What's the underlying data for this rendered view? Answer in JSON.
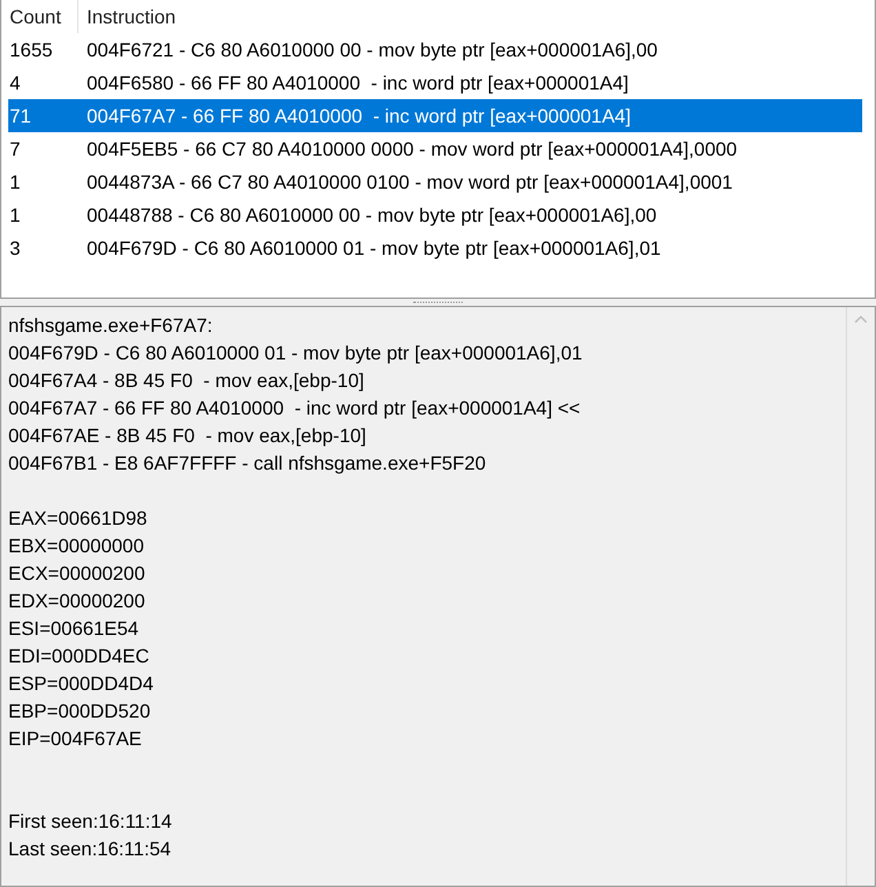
{
  "table": {
    "columns": [
      "Count",
      "Instruction"
    ],
    "rows": [
      {
        "count": "1655",
        "instruction": "004F6721 - C6 80 A6010000 00 - mov byte ptr [eax+000001A6],00",
        "selected": false
      },
      {
        "count": "4",
        "instruction": "004F6580 - 66 FF 80 A4010000  - inc word ptr [eax+000001A4]",
        "selected": false
      },
      {
        "count": "71",
        "instruction": "004F67A7 - 66 FF 80 A4010000  - inc word ptr [eax+000001A4]",
        "selected": true
      },
      {
        "count": "7",
        "instruction": "004F5EB5 - 66 C7 80 A4010000 0000 - mov word ptr [eax+000001A4],0000",
        "selected": false
      },
      {
        "count": "1",
        "instruction": "0044873A - 66 C7 80 A4010000 0100 - mov word ptr [eax+000001A4],0001",
        "selected": false
      },
      {
        "count": "1",
        "instruction": "00448788 - C6 80 A6010000 00 - mov byte ptr [eax+000001A6],00",
        "selected": false
      },
      {
        "count": "3",
        "instruction": "004F679D - C6 80 A6010000 01 - mov byte ptr [eax+000001A6],01",
        "selected": false
      }
    ]
  },
  "details": {
    "address": "nfshsgame.exe+F67A7:",
    "code_lines": [
      "004F679D - C6 80 A6010000 01 - mov byte ptr [eax+000001A6],01",
      "004F67A4 - 8B 45 F0  - mov eax,[ebp-10]",
      "004F67A7 - 66 FF 80 A4010000  - inc word ptr [eax+000001A4] <<",
      "004F67AE - 8B 45 F0  - mov eax,[ebp-10]",
      "004F67B1 - E8 6AF7FFFF - call nfshsgame.exe+F5F20"
    ],
    "registers": [
      "EAX=00661D98",
      "EBX=00000000",
      "ECX=00000200",
      "EDX=00000200",
      "ESI=00661E54",
      "EDI=000DD4EC",
      "ESP=000DD4D4",
      "EBP=000DD520",
      "EIP=004F67AE"
    ],
    "timestamps": [
      "First seen:16:11:14",
      "Last seen:16:11:54"
    ]
  }
}
